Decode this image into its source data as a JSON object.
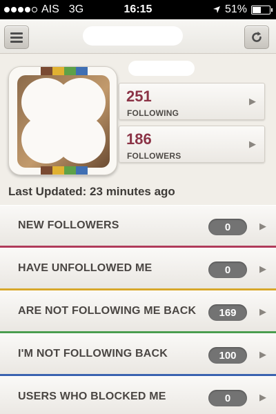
{
  "status_bar": {
    "carrier": "AIS",
    "network": "3G",
    "time": "16:15",
    "battery": "51%",
    "battery_level": 0.51
  },
  "nav": {
    "menu_icon": "hamburger-menu-icon",
    "refresh_icon": "refresh-icon"
  },
  "profile": {
    "following_count": "251",
    "following_label": "FOLLOWING",
    "followers_count": "186",
    "followers_label": "FOLLOWERS",
    "last_updated": "Last Updated: 23 minutes ago",
    "rainbow_colors": [
      "#7a4a32",
      "#e0b132",
      "#5da148",
      "#3f6fb3"
    ]
  },
  "list": [
    {
      "label": "NEW FOLLOWERS",
      "count": "0",
      "accent": "#b03a5a"
    },
    {
      "label": "HAVE UNFOLLOWED ME",
      "count": "0",
      "accent": "#d7a72a"
    },
    {
      "label": "ARE NOT FOLLOWING ME BACK",
      "count": "169",
      "accent": "#4b9d4f"
    },
    {
      "label": "I'M NOT FOLLOWING BACK",
      "count": "100",
      "accent": "#3a62b0"
    },
    {
      "label": "USERS WHO BLOCKED ME",
      "count": "0",
      "accent": "#b03a5a"
    }
  ],
  "colors": {
    "stat_number": "#8b3346",
    "pill_bg": "#737373"
  }
}
